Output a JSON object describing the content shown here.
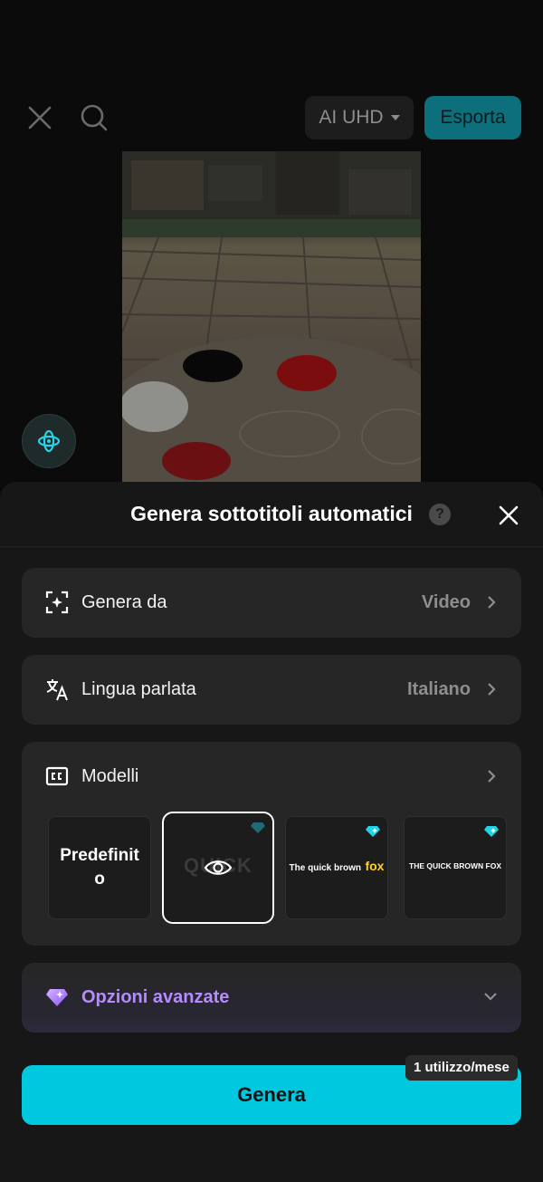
{
  "topbar": {
    "close_icon": "close-icon",
    "search_icon": "search-icon",
    "quality_label": "AI UHD",
    "export_label": "Esporta"
  },
  "sheet": {
    "title": "Genera sottotitoli automatici",
    "help_glyph": "?",
    "rows": [
      {
        "icon": "sparkle-scan-icon",
        "label": "Genera da",
        "value": "Video"
      },
      {
        "icon": "translate-icon",
        "label": "Lingua parlata",
        "value": "Italiano"
      }
    ],
    "templates": {
      "icon": "closed-caption-icon",
      "label": "Modelli",
      "items": [
        {
          "label": "Predefinit o"
        },
        {
          "label": "QUICK",
          "selected": true
        },
        {
          "label_a": "The quick brown",
          "label_b": "fox",
          "premium": true
        },
        {
          "label": "THE QUICK BROWN FOX",
          "premium": true
        }
      ]
    },
    "advanced": {
      "icon": "diamond-icon",
      "label": "Opzioni avanzate"
    },
    "generate_label": "Genera",
    "usage_badge": "1 utilizzo/mese"
  },
  "colors": {
    "accent": "#00c9df",
    "premium": "#b58bff",
    "sheet_bg": "#171717",
    "card_bg": "#262626"
  }
}
